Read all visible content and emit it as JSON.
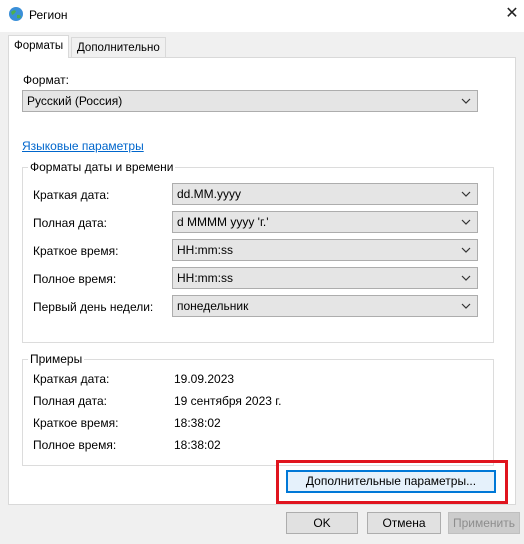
{
  "window": {
    "title": "Регион",
    "icon": "globe-icon"
  },
  "tabs": [
    {
      "label": "Форматы",
      "active": true
    },
    {
      "label": "Дополнительно",
      "active": false
    }
  ],
  "format": {
    "label": "Формат:",
    "value": "Русский (Россия)"
  },
  "language_link": "Языковые параметры",
  "date_time_formats": {
    "title": "Форматы даты и времени",
    "rows": [
      {
        "label": "Краткая дата:",
        "value": "dd.MM.yyyy"
      },
      {
        "label": "Полная дата:",
        "value": "d MMMM yyyy 'г.'"
      },
      {
        "label": "Краткое время:",
        "value": "HH:mm:ss"
      },
      {
        "label": "Полное время:",
        "value": "HH:mm:ss"
      },
      {
        "label": "Первый день недели:",
        "value": "понедельник"
      }
    ]
  },
  "examples": {
    "title": "Примеры",
    "rows": [
      {
        "label": "Краткая дата:",
        "value": "19.09.2023"
      },
      {
        "label": "Полная дата:",
        "value": "19 сентября 2023 г."
      },
      {
        "label": "Краткое время:",
        "value": "18:38:02"
      },
      {
        "label": "Полное время:",
        "value": "18:38:02"
      }
    ]
  },
  "buttons": {
    "additional": "Дополнительные параметры...",
    "ok": "OK",
    "cancel": "Отмена",
    "apply": "Применить"
  },
  "colors": {
    "highlight": "#e0141e",
    "link": "#0066cc",
    "focus": "#0078d7"
  }
}
